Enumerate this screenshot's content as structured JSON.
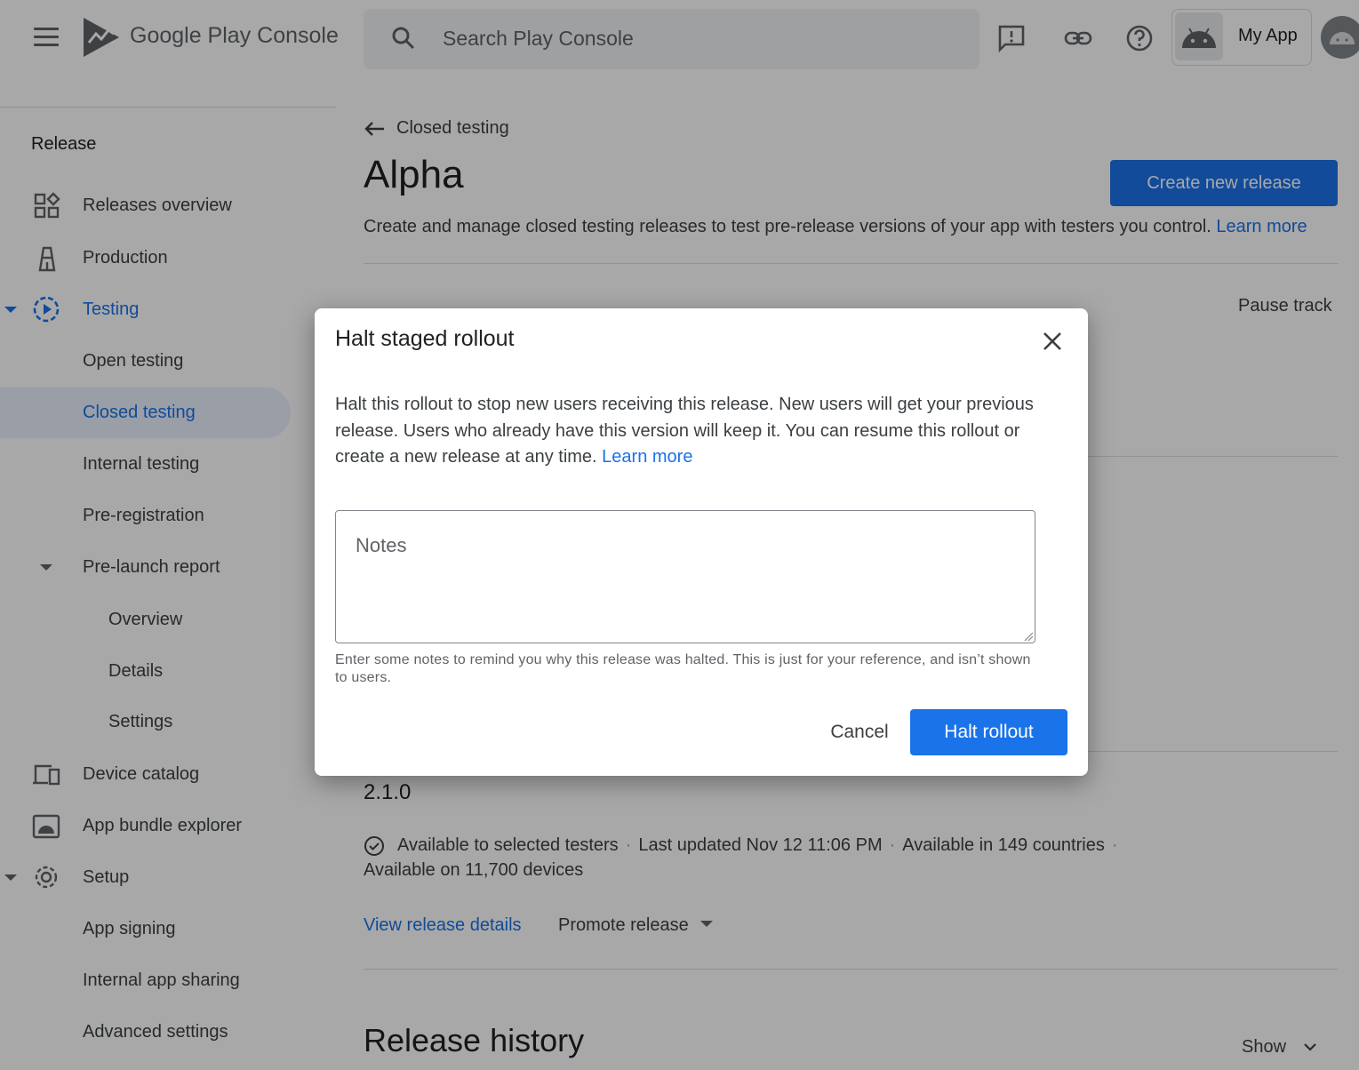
{
  "header": {
    "logo_text": "Google Play Console",
    "search_placeholder": "Search Play Console",
    "app_name": "My App"
  },
  "sidebar": {
    "section": "Release",
    "items": [
      {
        "label": "Releases overview",
        "icon": "grid-icon"
      },
      {
        "label": "Production",
        "icon": "lighthouse-icon"
      },
      {
        "label": "Testing",
        "icon": "play-circle-icon",
        "active": true
      },
      {
        "label": "Open testing"
      },
      {
        "label": "Closed testing",
        "selected": true
      },
      {
        "label": "Internal testing"
      },
      {
        "label": "Pre-registration"
      },
      {
        "label": "Pre-launch report"
      },
      {
        "label": "Overview"
      },
      {
        "label": "Details"
      },
      {
        "label": "Settings"
      },
      {
        "label": "Device catalog",
        "icon": "devices-icon"
      },
      {
        "label": "App bundle explorer",
        "icon": "android-box-icon"
      },
      {
        "label": "Setup",
        "icon": "gear-icon"
      },
      {
        "label": "App signing"
      },
      {
        "label": "Internal app sharing"
      },
      {
        "label": "Advanced settings"
      }
    ]
  },
  "main": {
    "breadcrumb": "Closed testing",
    "title": "Alpha",
    "create_button": "Create new release",
    "description": "Create and manage closed testing releases to test pre-release versions of your app with testers you control.",
    "description_link": "Learn more",
    "pause_track": "Pause track",
    "release": {
      "version": "2.1.0",
      "status": "Available to selected testers",
      "updated": "Last updated Nov 12 11:06 PM",
      "countries": "Available in 149 countries",
      "devices": "Available on 11,700 devices",
      "view_details": "View release details",
      "promote": "Promote release"
    },
    "history_title": "Release history",
    "show_label": "Show"
  },
  "dialog": {
    "title": "Halt staged rollout",
    "body": "Halt this rollout to stop new users receiving this release. New users will get your previous release. Users who already have this version will keep it. You can resume this rollout or create a new release at any time.",
    "body_link": "Learn more",
    "notes_placeholder": "Notes",
    "helper": "Enter some notes to remind you why this release was halted. This is just for your reference, and isn’t shown to users.",
    "cancel": "Cancel",
    "confirm": "Halt rollout"
  },
  "colors": {
    "accent": "#1a73e8",
    "scrim": "rgba(0,0,0,0.34)"
  }
}
